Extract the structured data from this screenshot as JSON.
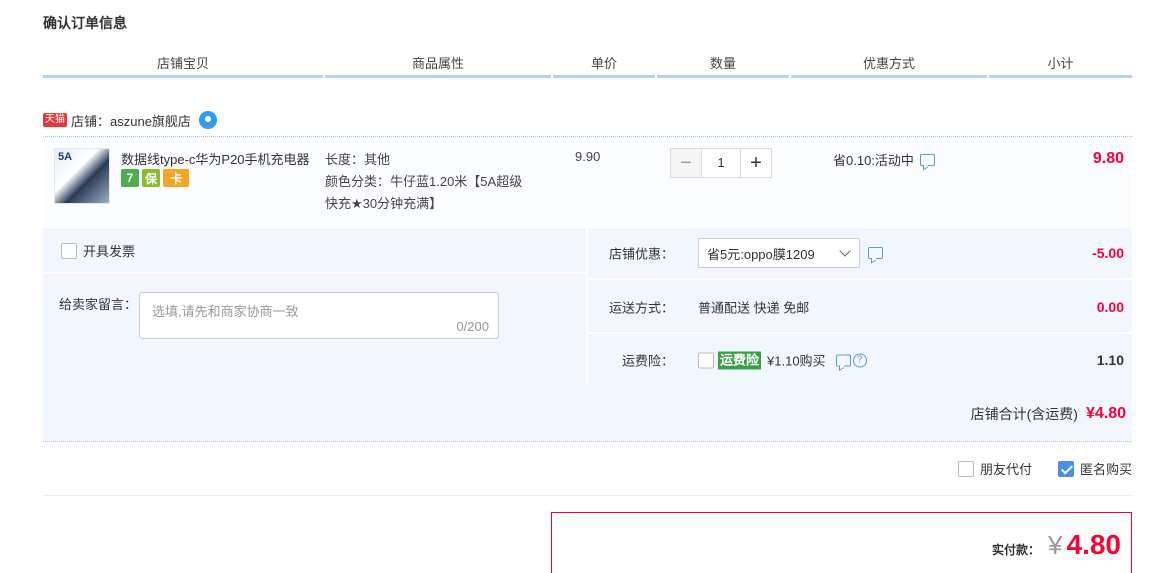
{
  "page_title": "确认订单信息",
  "columns": [
    "店铺宝贝",
    "商品属性",
    "单价",
    "数量",
    "优惠方式",
    "小计"
  ],
  "shop": {
    "badge": "天猫",
    "label": "店铺：aszune旗舰店"
  },
  "item": {
    "thumb_text": "5A",
    "title": "数据线type-c华为P20手机充电器",
    "service_icons": [
      "7",
      "保",
      "卡"
    ],
    "props": {
      "length": "长度：其他",
      "color": "颜色分类：牛仔蓝1.20米【5A超级快充★30分钟充满】"
    },
    "unit_price": "9.90",
    "quantity": "1",
    "qty_minus": "−",
    "qty_plus": "+",
    "promo": "省0.10:活动中",
    "subtotal": "9.80"
  },
  "extras": {
    "invoice_label": "开具发票",
    "message_label": "给卖家留言：",
    "message_placeholder": "选填,请先和商家协商一致",
    "message_count": "0/200",
    "shop_discount_label": "店铺优惠：",
    "shop_discount_value": "省5元:oppo膜1209",
    "shop_discount_amount": "-5.00",
    "shipping_label": "运送方式：",
    "shipping_value": "普通配送 快递 免邮",
    "shipping_amount": "0.00",
    "insurance_label": "运费险：",
    "insurance_badge": "运费险",
    "insurance_value": "¥1.10购买",
    "insurance_amount": "1.10",
    "help_glyph": "?"
  },
  "shop_total": {
    "label": "店铺合计(含运费)",
    "amount": "¥4.80"
  },
  "options": {
    "friend_pay": "朋友代付",
    "anonymous": "匿名购买"
  },
  "payment": {
    "label": "实付款：",
    "yen": "¥",
    "amount": "4.80"
  },
  "colors": {
    "accent_red": "#ff0036",
    "header_line": "#b2d1ff",
    "panel_bg": "#f2f7ff",
    "checkbox_blue": "#4a90e2",
    "insurance_green": "#3aa045"
  },
  "icons": [
    "tmall-badge",
    "wangwang-icon",
    "chat-icon",
    "help-icon",
    "chevron-down-icon",
    "checkbox"
  ]
}
